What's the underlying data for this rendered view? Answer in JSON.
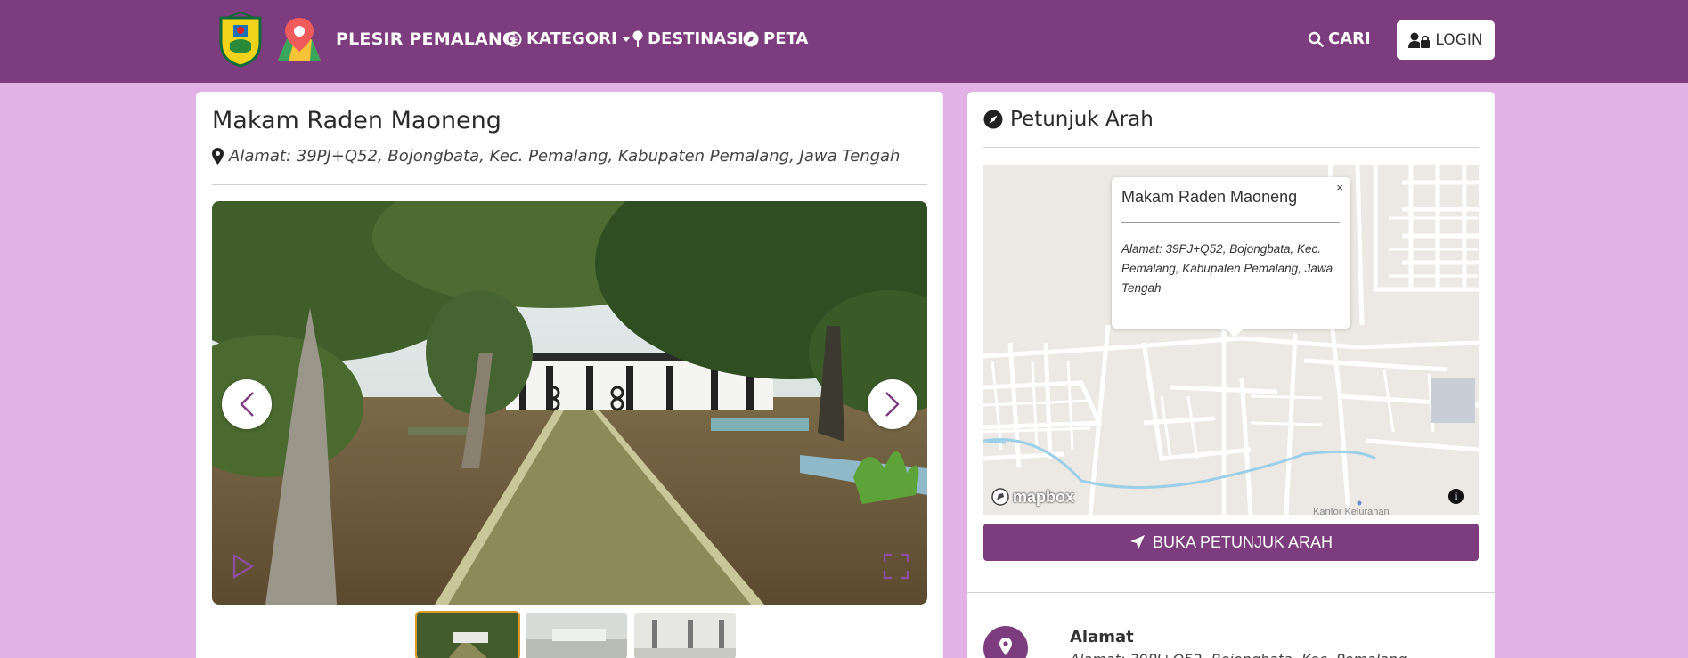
{
  "navbar": {
    "brand": "PLESIR PEMALANG",
    "items": [
      {
        "label": "KATEGORI",
        "icon": "list-circle-icon",
        "dropdown": true
      },
      {
        "label": "DESTINASI",
        "icon": "pin-icon"
      },
      {
        "label": "PETA",
        "icon": "compass-icon"
      }
    ],
    "search_label": "CARI",
    "login_label": "LOGIN",
    "color": "#7c3c7e"
  },
  "place": {
    "title": "Makam Raden Maoneng",
    "address": "Alamat: 39PJ+Q52, Bojongbata, Kec. Pemalang, Kabupaten Pemalang, Jawa Tengah"
  },
  "directions": {
    "title": "Petunjuk Arah",
    "popup_title": "Makam Raden Maoneng",
    "popup_close": "×",
    "popup_address": "Alamat: 39PJ+Q52, Bojongbata, Kec. Pemalang, Kabupaten Pemalang, Jawa Tengah",
    "mapbox_label": "mapbox",
    "info_label": "i",
    "map_label": "Kantor Kelurahan",
    "button_label": "BUKA PETUNJUK ARAH"
  },
  "detail": {
    "address_label": "Alamat",
    "address_value": "Alamat: 39PJ+Q52, Bojongbata, Kec. Pemalang"
  },
  "colors": {
    "background": "#e2b2e6",
    "accent": "#7c3c7e"
  }
}
